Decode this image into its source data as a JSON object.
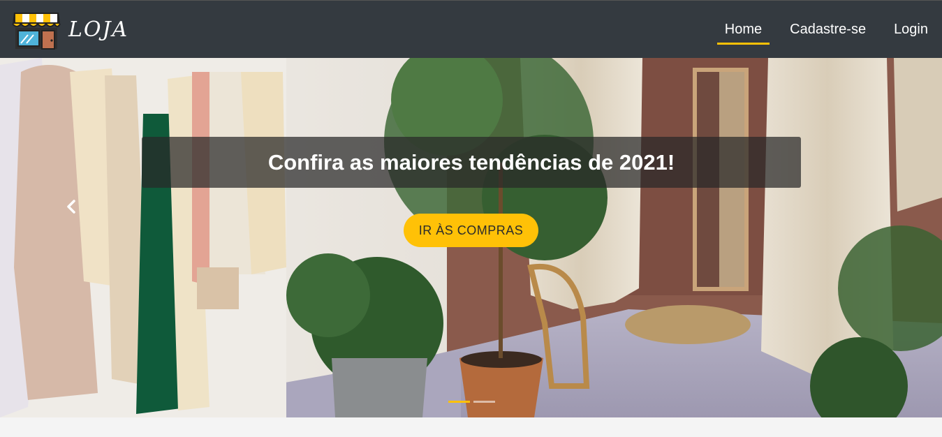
{
  "navbar": {
    "brand_text": "LOJA",
    "brand_icon": "storefront-icon",
    "links": [
      {
        "label": "Home",
        "active": true
      },
      {
        "label": "Cadastre-se",
        "active": false
      },
      {
        "label": "Login",
        "active": false
      }
    ]
  },
  "carousel": {
    "caption": "Confira as maiores tendências de 2021!",
    "cta_label": "IR ÀS COMPRAS",
    "prev_icon": "chevron-left-icon",
    "slide_count": 2,
    "active_slide": 1
  },
  "colors": {
    "navbar_bg": "#343a40",
    "accent": "#ffc107",
    "page_bg": "#f4f4f4"
  }
}
